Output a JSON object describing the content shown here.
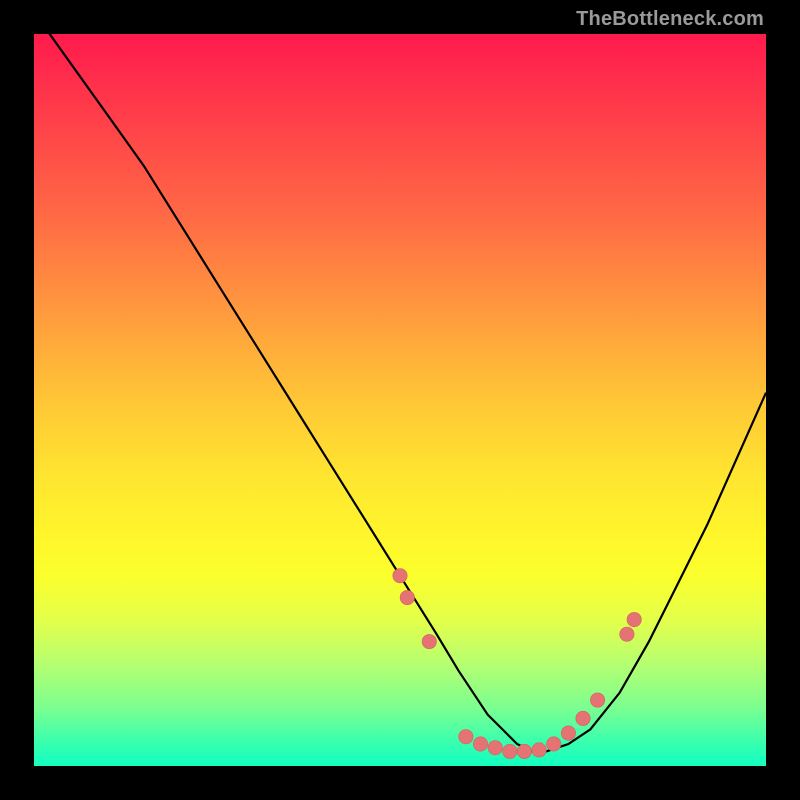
{
  "watermark": "TheBottleneck.com",
  "colors": {
    "page_bg": "#000000",
    "gradient_top": "#ff1a4d",
    "gradient_bottom": "#12ffc0",
    "curve": "#000000",
    "dot_fill": "#e57373"
  },
  "chart_data": {
    "type": "line",
    "title": "",
    "xlabel": "",
    "ylabel": "",
    "xlim": [
      0,
      100
    ],
    "ylim": [
      0,
      100
    ],
    "grid": false,
    "legend": false,
    "series": [
      {
        "name": "bottleneck-curve",
        "x": [
          0,
          5,
          10,
          15,
          20,
          25,
          30,
          35,
          40,
          45,
          50,
          55,
          58,
          60,
          62,
          64,
          66,
          68,
          70,
          73,
          76,
          80,
          84,
          88,
          92,
          96,
          100
        ],
        "y": [
          103,
          96,
          89,
          82,
          74,
          66,
          58,
          50,
          42,
          34,
          26,
          18,
          13,
          10,
          7,
          5,
          3,
          2,
          2,
          3,
          5,
          10,
          17,
          25,
          33,
          42,
          51
        ]
      }
    ],
    "points": [
      {
        "x": 50,
        "y": 26
      },
      {
        "x": 51,
        "y": 23
      },
      {
        "x": 54,
        "y": 17
      },
      {
        "x": 59,
        "y": 4
      },
      {
        "x": 61,
        "y": 3
      },
      {
        "x": 63,
        "y": 2.5
      },
      {
        "x": 65,
        "y": 2
      },
      {
        "x": 67,
        "y": 2
      },
      {
        "x": 69,
        "y": 2.2
      },
      {
        "x": 71,
        "y": 3
      },
      {
        "x": 73,
        "y": 4.5
      },
      {
        "x": 75,
        "y": 6.5
      },
      {
        "x": 77,
        "y": 9
      },
      {
        "x": 81,
        "y": 18
      },
      {
        "x": 82,
        "y": 20
      }
    ]
  }
}
